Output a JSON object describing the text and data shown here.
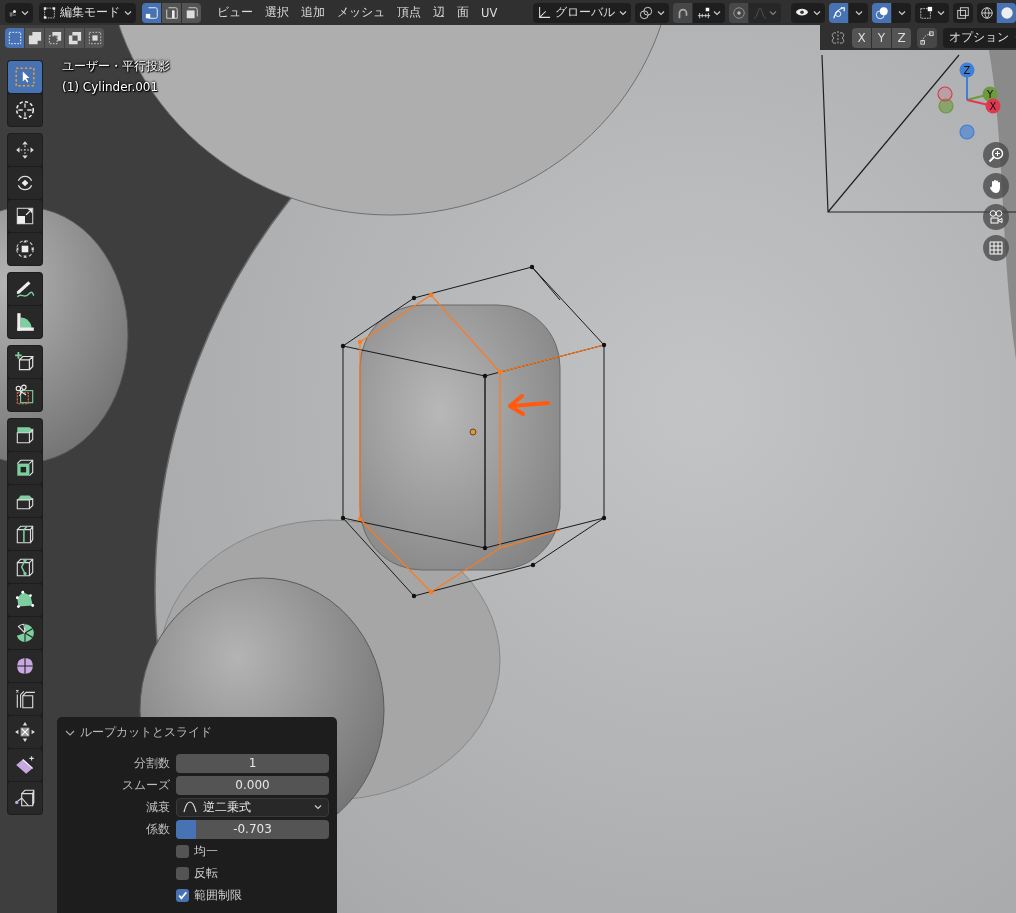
{
  "header": {
    "mode": "編集モード",
    "select_modes": [
      {
        "kind": "vertex",
        "selected": true
      },
      {
        "kind": "edge",
        "selected": false
      },
      {
        "kind": "face",
        "selected": false
      }
    ],
    "menus": [
      "ビュー",
      "選択",
      "追加",
      "メッシュ",
      "頂点",
      "辺",
      "面",
      "UV"
    ],
    "orientation": "グローバル",
    "snap": {
      "on": false
    },
    "proportional_edit": {
      "on": false
    },
    "gizmos": {
      "on": true
    },
    "overlays": {
      "on": true
    },
    "shading": [
      {
        "kind": "wireframe",
        "selected": false
      },
      {
        "kind": "solid",
        "selected": true
      }
    ]
  },
  "tool_settings": {
    "box_modes": [
      {
        "kind": "new",
        "selected": true
      },
      {
        "kind": "extend",
        "selected": false
      },
      {
        "kind": "subtract",
        "selected": false
      },
      {
        "kind": "invert",
        "selected": false
      },
      {
        "kind": "intersect",
        "selected": false
      }
    ],
    "mirror_axes": [
      {
        "label": "X",
        "on": false
      },
      {
        "label": "Y",
        "on": false
      },
      {
        "label": "Z",
        "on": false
      }
    ],
    "options": "オプション"
  },
  "viewport": {
    "view_name": "ユーザー・平行投影",
    "object_name": "(1) Cylinder.001",
    "axes": [
      {
        "label": "Z",
        "color": "#3f7fd8"
      },
      {
        "label": "Y",
        "color": "#6c9a3c"
      },
      {
        "label": "X",
        "color": "#e0384f"
      }
    ]
  },
  "toolbar": {
    "groups": [
      {
        "tools": [
          {
            "kind": "select_box",
            "selected": true
          },
          {
            "kind": "cursor",
            "selected": false
          }
        ]
      },
      {
        "tools": [
          {
            "kind": "move",
            "selected": false
          },
          {
            "kind": "rotate",
            "selected": false
          },
          {
            "kind": "scale",
            "selected": false
          },
          {
            "kind": "transform",
            "selected": false
          }
        ]
      },
      {
        "tools": [
          {
            "kind": "annotate",
            "selected": false
          },
          {
            "kind": "measure",
            "selected": false
          }
        ]
      },
      {
        "tools": [
          {
            "kind": "add_cube",
            "selected": false
          },
          {
            "kind": "cut",
            "selected": false
          }
        ]
      },
      {
        "tools": [
          {
            "kind": "extrude",
            "selected": false
          },
          {
            "kind": "inset",
            "selected": false
          },
          {
            "kind": "bevel",
            "selected": false
          },
          {
            "kind": "loop_cut",
            "selected": false
          },
          {
            "kind": "knife",
            "selected": false
          },
          {
            "kind": "poly_build",
            "selected": false
          },
          {
            "kind": "spin",
            "selected": false
          },
          {
            "kind": "smooth",
            "selected": false
          },
          {
            "kind": "edge_slide",
            "selected": false
          },
          {
            "kind": "shrink",
            "selected": false
          },
          {
            "kind": "shear",
            "selected": false
          },
          {
            "kind": "rip",
            "selected": false
          }
        ]
      }
    ]
  },
  "operator_panel": {
    "title": "ループカットとスライド",
    "expanded": true,
    "properties": [
      {
        "kind": "number",
        "label": "分割数",
        "value": "1"
      },
      {
        "kind": "number",
        "label": "スムーズ",
        "value": "0.000"
      },
      {
        "kind": "dropdown",
        "label": "減衰",
        "value": "逆二乗式"
      },
      {
        "kind": "slider",
        "label": "係数",
        "value": "-0.703",
        "level": 0.13
      },
      {
        "kind": "checkbox",
        "label": "均一",
        "checked": false
      },
      {
        "kind": "checkbox",
        "label": "反転",
        "checked": false
      },
      {
        "kind": "checkbox",
        "label": "範囲制限",
        "checked": true
      }
    ]
  }
}
